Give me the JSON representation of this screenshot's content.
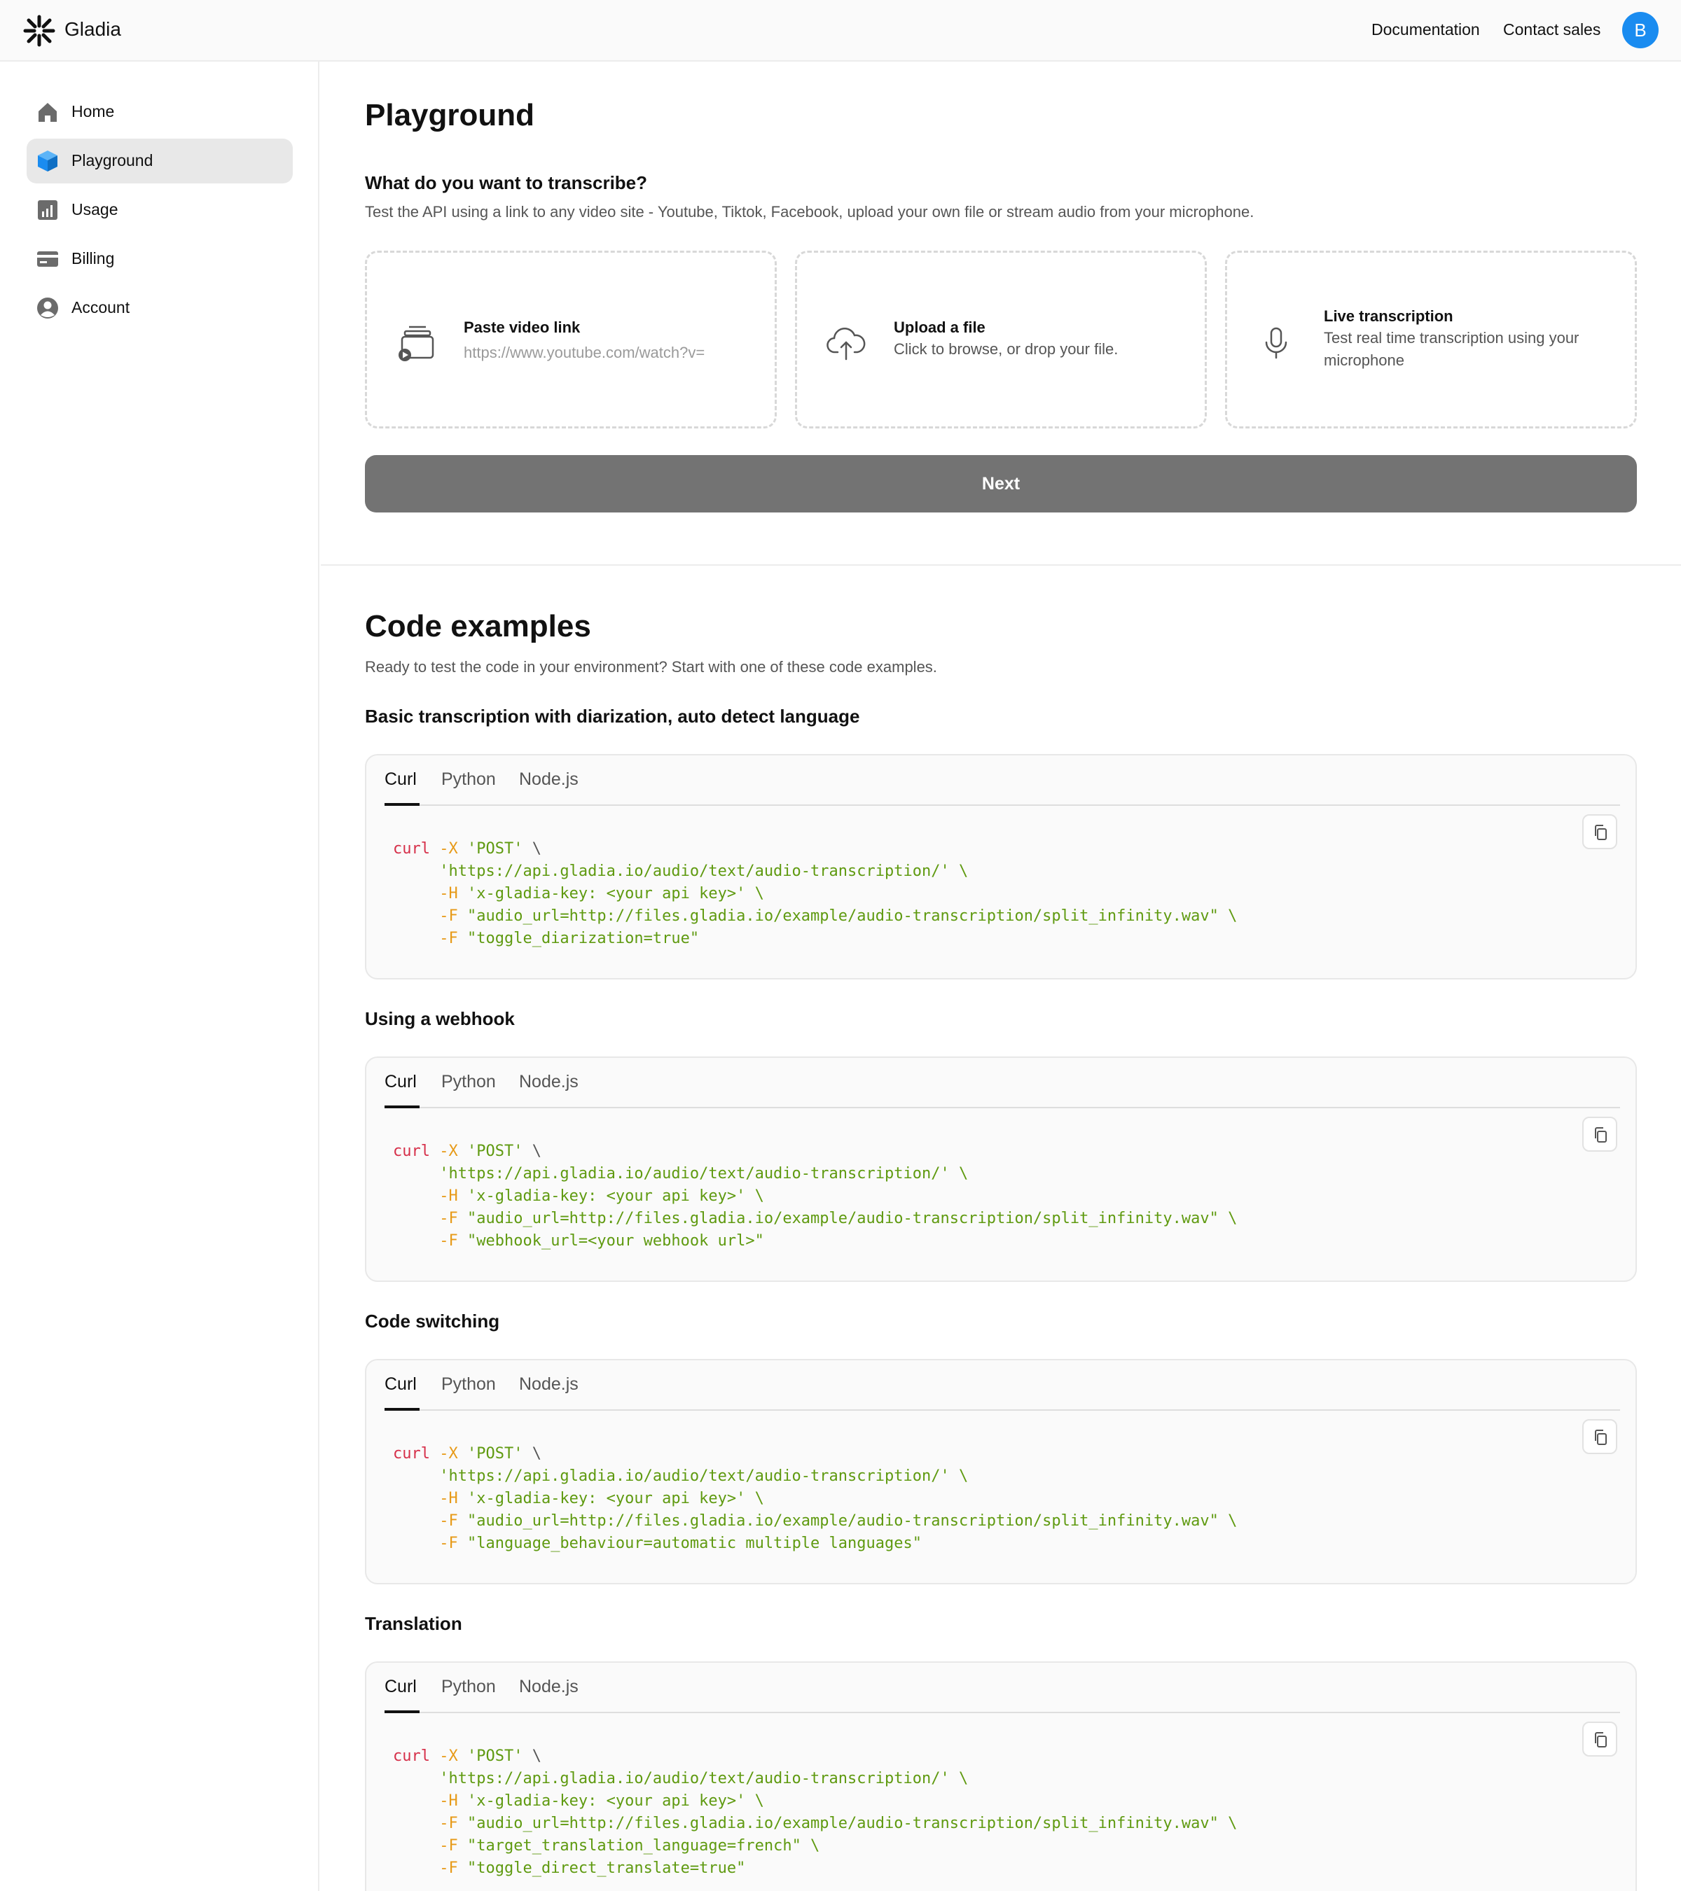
{
  "topbar": {
    "brand": "Gladia",
    "documentation": "Documentation",
    "contact_sales": "Contact sales",
    "avatar_initial": "B"
  },
  "sidebar": {
    "items": [
      {
        "label": "Home",
        "icon": "home-icon"
      },
      {
        "label": "Playground",
        "icon": "cube-icon",
        "active": true
      },
      {
        "label": "Usage",
        "icon": "chart-icon"
      },
      {
        "label": "Billing",
        "icon": "card-icon"
      },
      {
        "label": "Account",
        "icon": "user-icon"
      }
    ]
  },
  "playground": {
    "title": "Playground",
    "question": "What do you want to transcribe?",
    "description": "Test the API using a link to any video site - Youtube, Tiktok, Facebook, upload your own file or stream audio from your microphone.",
    "options": {
      "video": {
        "title": "Paste video link",
        "placeholder": "https://www.youtube.com/watch?v=",
        "icon": "video-link-icon"
      },
      "upload": {
        "title": "Upload a file",
        "desc": "Click to browse, or drop your file.",
        "icon": "cloud-upload-icon"
      },
      "live": {
        "title": "Live transcription",
        "desc": "Test real time transcription using your microphone",
        "icon": "microphone-icon"
      }
    },
    "next_label": "Next"
  },
  "code_examples": {
    "title": "Code examples",
    "description": "Ready to test the code in your environment? Start with one of these code examples.",
    "tabs": [
      "Curl",
      "Python",
      "Node.js"
    ],
    "examples": [
      {
        "title": "Basic transcription with diarization, auto detect language",
        "lines": [
          "'https://api.gladia.io/audio/text/audio-transcription/' \\",
          "'x-gladia-key: <your api key>' \\",
          "\"audio_url=http://files.gladia.io/example/audio-transcription/split_infinity.wav\" \\",
          "\"toggle_diarization=true\""
        ]
      },
      {
        "title": "Using a webhook",
        "lines": [
          "'https://api.gladia.io/audio/text/audio-transcription/' \\",
          "'x-gladia-key: <your api key>' \\",
          "\"audio_url=http://files.gladia.io/example/audio-transcription/split_infinity.wav\" \\",
          "\"webhook_url=<your webhook url>\""
        ]
      },
      {
        "title": "Code switching",
        "lines": [
          "'https://api.gladia.io/audio/text/audio-transcription/' \\",
          "'x-gladia-key: <your api key>' \\",
          "\"audio_url=http://files.gladia.io/example/audio-transcription/split_infinity.wav\" \\",
          "\"language_behaviour=automatic multiple languages\""
        ]
      },
      {
        "title": "Translation",
        "lines": [
          "'https://api.gladia.io/audio/text/audio-transcription/' \\",
          "'x-gladia-key: <your api key>' \\",
          "\"audio_url=http://files.gladia.io/example/audio-transcription/split_infinity.wav\" \\",
          "\"target_translation_language=french\" \\",
          "\"toggle_direct_translate=true\""
        ]
      }
    ],
    "curl_cmd": "curl",
    "curl_x_flag": "-X",
    "curl_method": "'POST'",
    "curl_continuation": "\\",
    "curl_header_flag": "-H",
    "curl_form_flag": "-F"
  },
  "colors": {
    "accent": "#1a8cf0",
    "next_button": "#737373",
    "code_cmd": "#d6304a",
    "code_flag": "#e79a18",
    "code_string": "#5f9a10"
  }
}
